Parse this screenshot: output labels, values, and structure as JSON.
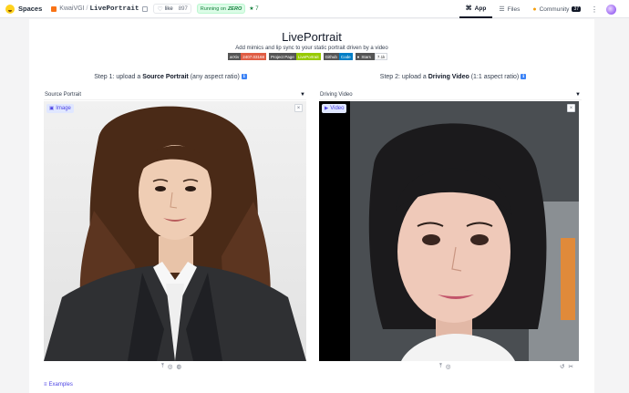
{
  "header": {
    "spaces_label": "Spaces",
    "owner": "KwaiVGI",
    "separator": "/",
    "repo": "LivePortrait",
    "like_icon": "heart-icon",
    "like_label": "like",
    "like_count": "897",
    "running_label": "Running on",
    "running_hw": "ZERO",
    "star_count": "★ 7",
    "tabs": [
      {
        "label": "App",
        "icon": "app-icon"
      },
      {
        "label": "Files",
        "icon": "files-icon"
      },
      {
        "label": "Community",
        "icon": "community-icon",
        "badge": "37"
      }
    ],
    "more": "⋮"
  },
  "app": {
    "title": "LivePortrait",
    "subtitle": "Add mimics and lip sync to your static portrait driven by a video",
    "badges": [
      {
        "left": "arXiv",
        "right": "2407.03168"
      },
      {
        "left": "Project Page",
        "right": "LivePortrait"
      },
      {
        "left": "Github",
        "right": "Code"
      },
      {
        "left": "Stars",
        "right": "7.1k"
      }
    ],
    "step1": {
      "prefix": "Step 1: upload a",
      "bold": "Source Portrait",
      "suffix": "(any aspect ratio)",
      "info": "ℹ"
    },
    "step2": {
      "prefix": "Step 2: upload a",
      "bold": "Driving Video",
      "suffix": "(1:1 aspect ratio)",
      "info": "ℹ"
    },
    "source": {
      "label": "Source Portrait",
      "tag": "Image",
      "close": "×"
    },
    "driving": {
      "label": "Driving Video",
      "tag": "Video",
      "close": "×"
    },
    "source_tools": [
      "⤒",
      "◎",
      "◍"
    ],
    "driving_tools": [
      "⤒",
      "◎"
    ],
    "driving_right_tools": [
      "↺",
      "✂"
    ],
    "examples_label": "Examples",
    "dropdown_glyph": "▼"
  },
  "colors": {
    "accent": "#4f46e5",
    "running_bg": "#dcfce7",
    "running_fg": "#15803d"
  }
}
